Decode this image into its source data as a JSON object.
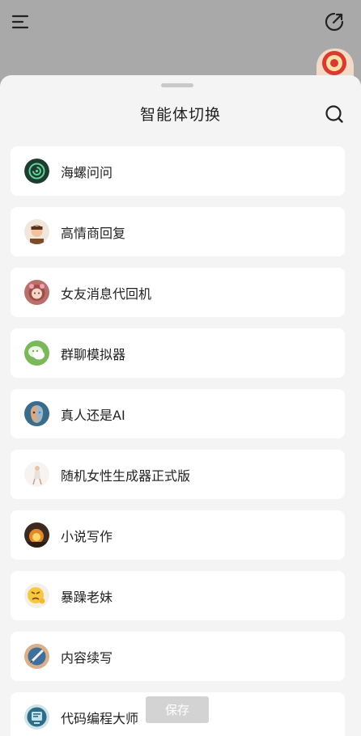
{
  "header": {
    "menu_icon": "hamburger-menu-icon",
    "edit_icon": "edit-external-icon"
  },
  "sheet": {
    "title": "智能体切换",
    "search_icon": "search-icon",
    "items": [
      {
        "label": "海螺问问",
        "avatar": "conch-logo"
      },
      {
        "label": "高情商回复",
        "avatar": "man-portrait"
      },
      {
        "label": "女友消息代回机",
        "avatar": "girl-portrait"
      },
      {
        "label": "群聊模拟器",
        "avatar": "chat-bubble-logo"
      },
      {
        "label": "真人还是AI",
        "avatar": "half-robot-face"
      },
      {
        "label": "随机女性生成器正式版",
        "avatar": "woman-figure"
      },
      {
        "label": "小说写作",
        "avatar": "fire-scene"
      },
      {
        "label": "暴躁老妹",
        "avatar": "angry-emoji"
      },
      {
        "label": "内容续写",
        "avatar": "pen-writing"
      },
      {
        "label": "代码编程大师",
        "avatar": "code-screen"
      }
    ],
    "save_label": "保存"
  },
  "colors": {
    "overlay": "#a9a9a9",
    "sheet_bg": "#f4f4f4",
    "card_bg": "#ffffff",
    "save_button_bg": "#d3d3d3"
  }
}
